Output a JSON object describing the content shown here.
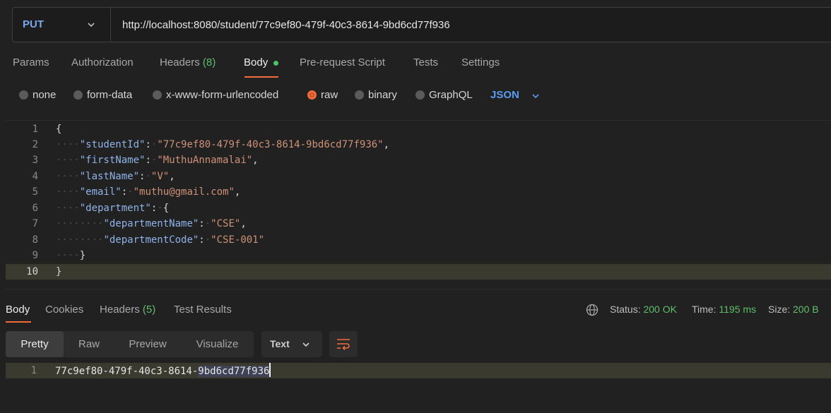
{
  "request": {
    "method": "PUT",
    "url": "http://localhost:8080/student/77c9ef80-479f-40c3-8614-9bd6cd77f936"
  },
  "request_tabs": {
    "params": "Params",
    "authorization": "Authorization",
    "headers": "Headers",
    "headers_count": "(8)",
    "body": "Body",
    "prerequest": "Pre-request Script",
    "tests": "Tests",
    "settings": "Settings"
  },
  "body_types": {
    "none": "none",
    "form_data": "form-data",
    "urlencoded": "x-www-form-urlencoded",
    "raw": "raw",
    "binary": "binary",
    "graphql": "GraphQL",
    "selected_format": "JSON"
  },
  "editor": {
    "line_numbers": [
      "1",
      "2",
      "3",
      "4",
      "5",
      "6",
      "7",
      "8",
      "9",
      "10"
    ],
    "open_brace": "{",
    "close_brace": "}",
    "fields": {
      "studentId_key": "\"studentId\"",
      "studentId_val": "\"77c9ef80-479f-40c3-8614-9bd6cd77f936\"",
      "firstName_key": "\"firstName\"",
      "firstName_val": "\"MuthuAnnamalai\"",
      "lastName_key": "\"lastName\"",
      "lastName_val": "\"V\"",
      "email_key": "\"email\"",
      "email_val": "\"muthu@gmail.com\"",
      "department_key": "\"department\"",
      "departmentName_key": "\"departmentName\"",
      "departmentName_val": "\"CSE\"",
      "departmentCode_key": "\"departmentCode\"",
      "departmentCode_val": "\"CSE-001\""
    }
  },
  "response_tabs": {
    "body": "Body",
    "cookies": "Cookies",
    "headers": "Headers",
    "headers_count": "(5)",
    "test_results": "Test Results"
  },
  "response_meta": {
    "status_label": "Status:",
    "status_value": "200 OK",
    "time_label": "Time:",
    "time_value": "1195 ms",
    "size_label": "Size:",
    "size_value": "200 B"
  },
  "view_modes": {
    "pretty": "Pretty",
    "raw": "Raw",
    "preview": "Preview",
    "visualize": "Visualize",
    "format": "Text"
  },
  "response_body": {
    "line_number": "1",
    "text_a": "77c9ef80-479f-40c3-8614-",
    "text_b": "9bd6cd77f936"
  }
}
